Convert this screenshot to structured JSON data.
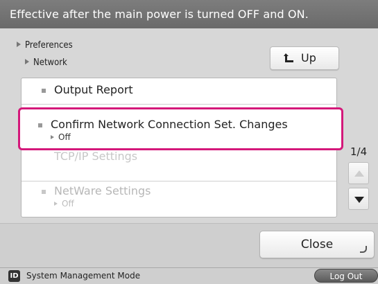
{
  "header": {
    "message": "Effective after the main power is turned OFF and ON."
  },
  "breadcrumb": {
    "level1": "Preferences",
    "level2": "Network"
  },
  "buttons": {
    "up_label": "Up",
    "close_label": "Close",
    "logout_label": "Log Out"
  },
  "list": {
    "items": [
      {
        "label": "Output Report"
      },
      {
        "label": "Confirm Network Connection Set. Changes",
        "value": "Off"
      },
      {
        "label": "TCP/IP Settings"
      },
      {
        "label": "NetWare Settings",
        "value": "Off"
      }
    ]
  },
  "pagination": {
    "indicator": "1/4"
  },
  "status": {
    "mode": "System Management Mode",
    "id_icon": "ID"
  },
  "colors": {
    "highlight": "#d4187a",
    "header_bg": "#737373"
  }
}
